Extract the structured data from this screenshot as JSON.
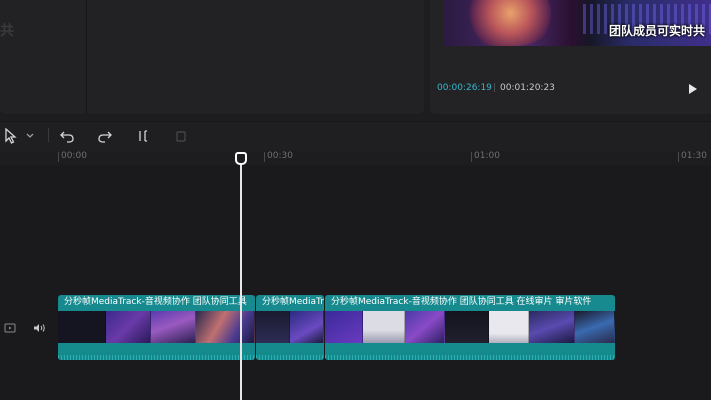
{
  "preview": {
    "left_ghost_text": "共",
    "subtitle": "团队成员可实时共",
    "current_time": "00:00:26:19",
    "separator": "|",
    "total_time": "00:01:20:23",
    "play_icon": "play-icon"
  },
  "toolbar": {
    "tools": [
      "select-cursor-icon",
      "chevron-down-icon",
      "undo-icon",
      "redo-icon",
      "split-icon",
      "delete-icon"
    ]
  },
  "ruler": {
    "ticks": [
      "00:00",
      "00:30",
      "01:00",
      "01:30"
    ]
  },
  "track_headers": {
    "icons": [
      "video-track-icon",
      "audio-volume-icon"
    ]
  },
  "clips": [
    {
      "label": "分秒帧MediaTrack-音视频协作 团队协同工具"
    },
    {
      "label": "分秒帧MediaTrack"
    },
    {
      "label": "分秒帧MediaTrack-音视频协作 团队协同工具 在线审片 审片软件"
    }
  ],
  "colors": {
    "accent_timecode": "#37b7d0",
    "clip": "#168a8e",
    "playhead": "#e7e7ea"
  }
}
